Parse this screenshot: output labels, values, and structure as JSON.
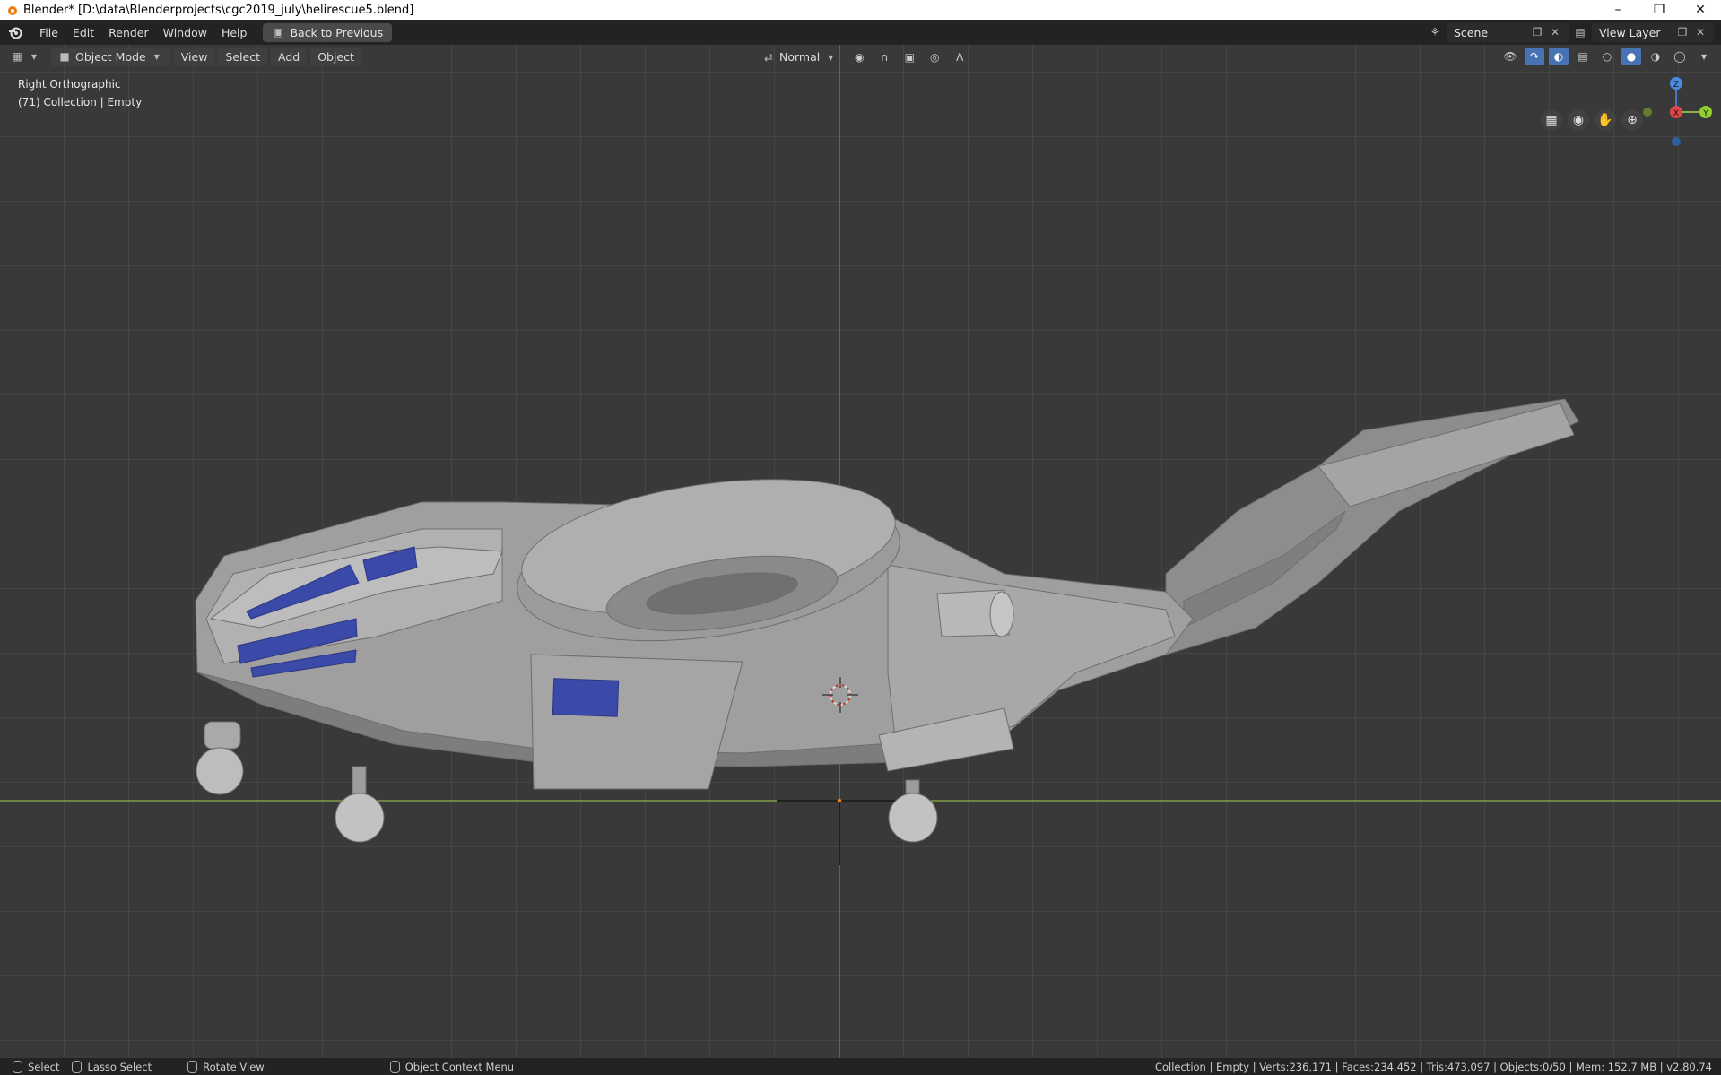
{
  "window": {
    "title": "Blender* [D:\\data\\Blenderprojects\\cgc2019_july\\helirescue5.blend]",
    "controls": [
      "minimize",
      "restore",
      "close"
    ]
  },
  "menubar": {
    "items": [
      "File",
      "Edit",
      "Render",
      "Window",
      "Help"
    ],
    "back_button": "Back to Previous",
    "scene_name": "Scene",
    "view_layer": "View Layer"
  },
  "viewport_header": {
    "mode": "Object Mode",
    "menus": [
      "View",
      "Select",
      "Add",
      "Object"
    ],
    "orientation": "Normal"
  },
  "viewport": {
    "view_name": "Right Orthographic",
    "collection_info": "(71) Collection | Empty",
    "gizmo": {
      "z": "Z",
      "x": "X",
      "y": "Y"
    }
  },
  "statusbar": {
    "select": "Select",
    "lasso": "Lasso Select",
    "rotate": "Rotate View",
    "context": "Object Context Menu",
    "stats": "Collection | Empty | Verts:236,171 | Faces:234,452 | Tris:473,097 | Objects:0/50 | Mem: 152.7 MB | v2.80.74"
  },
  "colors": {
    "background": "#393939",
    "axis_y_green": "#8fb04a",
    "axis_z_blue": "#4a78c8",
    "window_glass": "#3b4aa8",
    "accent": "#4772b3"
  }
}
